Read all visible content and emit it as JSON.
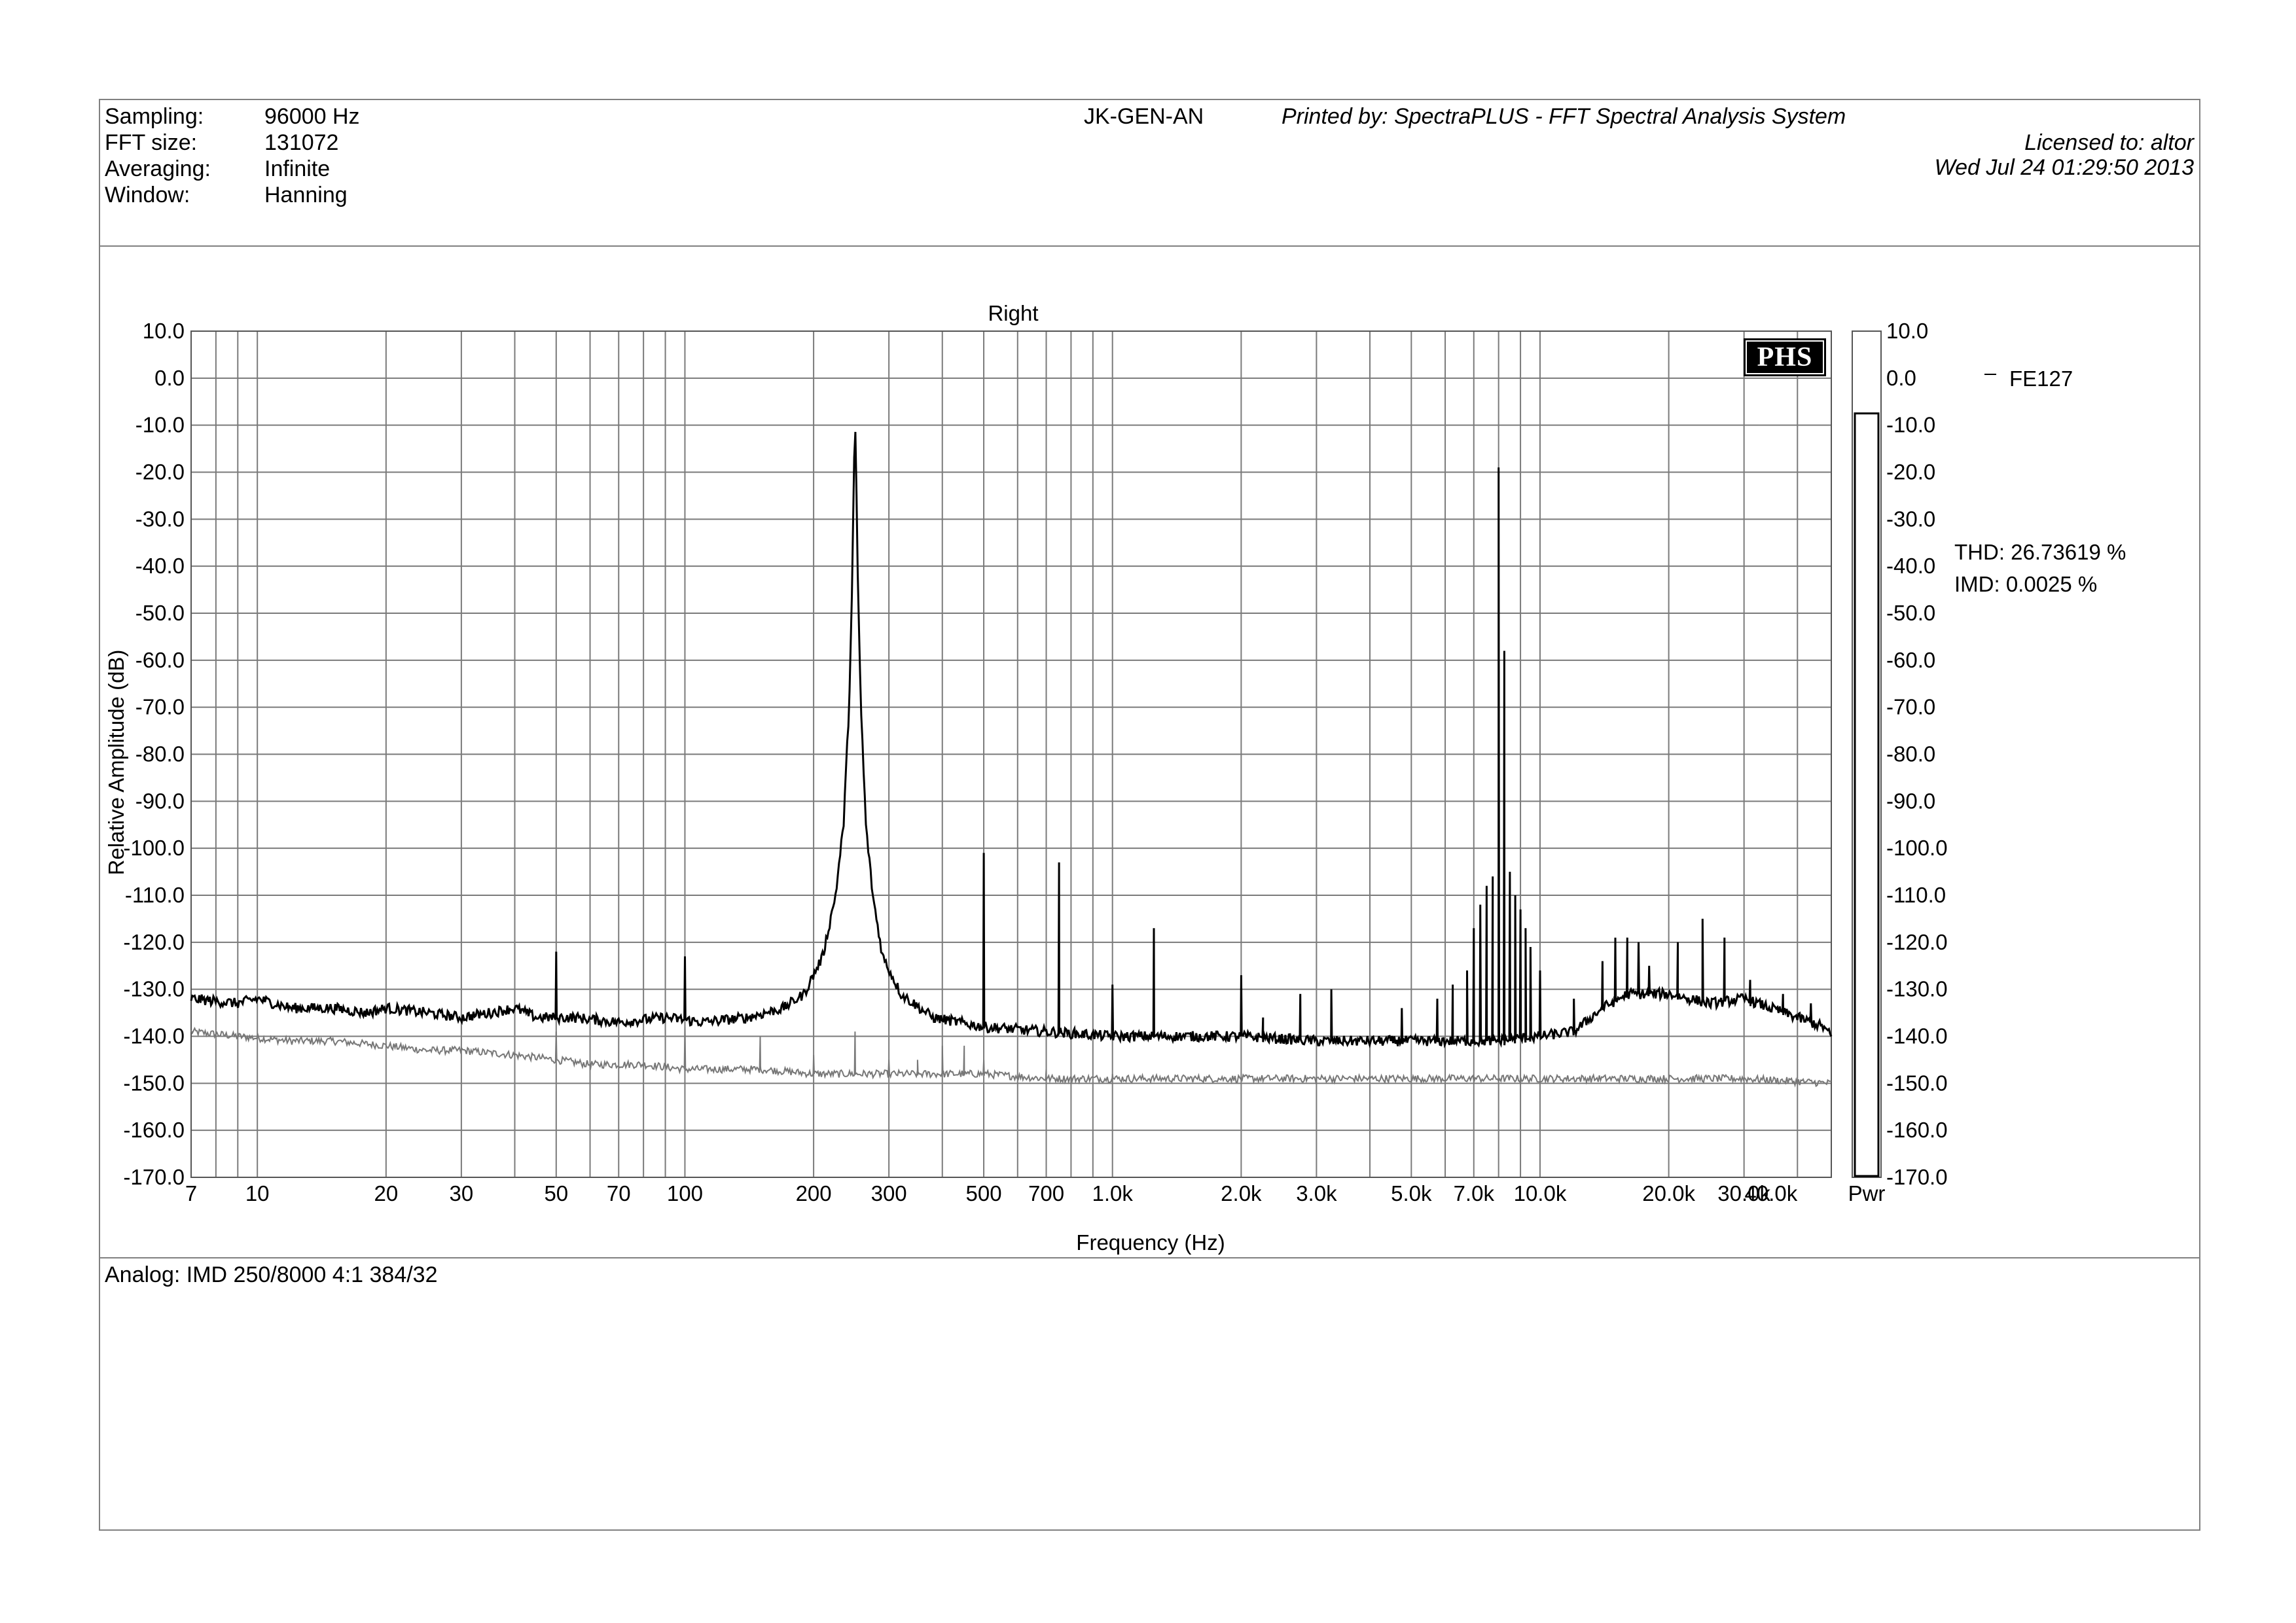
{
  "header": {
    "settings": [
      {
        "label": "Sampling:",
        "value": "96000 Hz"
      },
      {
        "label": "FFT size:",
        "value": "131072"
      },
      {
        "label": "Averaging:",
        "value": "Infinite"
      },
      {
        "label": "Window:",
        "value": "Hanning"
      }
    ],
    "device": "JK-GEN-AN",
    "printed_by": "Printed by: SpectraPLUS - FFT Spectral Analysis System",
    "licensed_to": "Licensed to: altor",
    "timestamp": "Wed Jul 24 01:29:50 2013"
  },
  "logo": {
    "text": "PHS"
  },
  "notes": {
    "text": "Analog: IMD 250/8000 4:1 384/32"
  },
  "measurements": {
    "thd": "THD: 26.73619 %",
    "imd": "IMD: 0.0025 %"
  },
  "chart_data": {
    "type": "line",
    "title": "Right",
    "xlabel": "Frequency (Hz)",
    "ylabel": "Relative Amplitude (dB)",
    "x_scale": "log",
    "xlim": [
      7,
      48000
    ],
    "ylim": [
      -170,
      10
    ],
    "grid": true,
    "legend_position": "right",
    "x_ticks": [
      {
        "value": 7,
        "label": "7"
      },
      {
        "value": 10,
        "label": "10"
      },
      {
        "value": 20,
        "label": "20"
      },
      {
        "value": 30,
        "label": "30"
      },
      {
        "value": 50,
        "label": "50"
      },
      {
        "value": 70,
        "label": "70"
      },
      {
        "value": 100,
        "label": "100"
      },
      {
        "value": 200,
        "label": "200"
      },
      {
        "value": 300,
        "label": "300"
      },
      {
        "value": 500,
        "label": "500"
      },
      {
        "value": 700,
        "label": "700"
      },
      {
        "value": 1000,
        "label": "1.0k"
      },
      {
        "value": 2000,
        "label": "2.0k"
      },
      {
        "value": 3000,
        "label": "3.0k"
      },
      {
        "value": 5000,
        "label": "5.0k"
      },
      {
        "value": 7000,
        "label": "7.0k"
      },
      {
        "value": 10000,
        "label": "10.0k"
      },
      {
        "value": 20000,
        "label": "20.0k"
      },
      {
        "value": 30000,
        "label": "30.0k"
      },
      {
        "value": 40000,
        "label": "40.0k"
      }
    ],
    "y_ticks": [
      {
        "value": 10,
        "label": "10.0"
      },
      {
        "value": 0,
        "label": "0.0"
      },
      {
        "value": -10,
        "label": "-10.0"
      },
      {
        "value": -20,
        "label": "-20.0"
      },
      {
        "value": -30,
        "label": "-30.0"
      },
      {
        "value": -40,
        "label": "-40.0"
      },
      {
        "value": -50,
        "label": "-50.0"
      },
      {
        "value": -60,
        "label": "-60.0"
      },
      {
        "value": -70,
        "label": "-70.0"
      },
      {
        "value": -80,
        "label": "-80.0"
      },
      {
        "value": -90,
        "label": "-90.0"
      },
      {
        "value": -100,
        "label": "-100.0"
      },
      {
        "value": -110,
        "label": "-110.0"
      },
      {
        "value": -120,
        "label": "-120.0"
      },
      {
        "value": -130,
        "label": "-130.0"
      },
      {
        "value": -140,
        "label": "-140.0"
      },
      {
        "value": -150,
        "label": "-150.0"
      },
      {
        "value": -160,
        "label": "-160.0"
      },
      {
        "value": -170,
        "label": "-170.0"
      }
    ],
    "series": [
      {
        "name": "FE127",
        "color": "#000000",
        "baseline": [
          [
            7,
            -132
          ],
          [
            9,
            -133
          ],
          [
            10,
            -132
          ],
          [
            12,
            -134
          ],
          [
            15,
            -134
          ],
          [
            18,
            -135
          ],
          [
            20,
            -134
          ],
          [
            25,
            -135
          ],
          [
            30,
            -136
          ],
          [
            35,
            -135
          ],
          [
            40,
            -134
          ],
          [
            45,
            -136
          ],
          [
            55,
            -136
          ],
          [
            70,
            -137
          ],
          [
            90,
            -136
          ],
          [
            110,
            -137
          ],
          [
            140,
            -136
          ],
          [
            170,
            -134
          ],
          [
            190,
            -131
          ],
          [
            210,
            -123
          ],
          [
            225,
            -110
          ],
          [
            235,
            -95
          ],
          [
            242,
            -70
          ],
          [
            246,
            -45
          ],
          [
            248,
            -25
          ],
          [
            250,
            -8.5
          ],
          [
            252,
            -25
          ],
          [
            254,
            -45
          ],
          [
            258,
            -70
          ],
          [
            265,
            -95
          ],
          [
            275,
            -110
          ],
          [
            290,
            -123
          ],
          [
            320,
            -131
          ],
          [
            380,
            -136
          ],
          [
            500,
            -138
          ],
          [
            700,
            -139
          ],
          [
            1000,
            -140
          ],
          [
            2000,
            -140
          ],
          [
            3000,
            -141
          ],
          [
            5000,
            -141
          ],
          [
            6000,
            -141
          ],
          [
            8000,
            -141
          ],
          [
            10000,
            -140
          ],
          [
            12000,
            -139
          ],
          [
            14000,
            -134
          ],
          [
            16000,
            -131
          ],
          [
            20000,
            -131
          ],
          [
            25000,
            -133
          ],
          [
            30000,
            -132
          ],
          [
            40000,
            -136
          ],
          [
            46000,
            -138
          ],
          [
            48000,
            -140
          ]
        ],
        "peaks": [
          [
            50,
            -122
          ],
          [
            100,
            -123
          ],
          [
            500,
            -101
          ],
          [
            750,
            -103
          ],
          [
            1000,
            -129
          ],
          [
            1250,
            -117
          ],
          [
            2000,
            -127
          ],
          [
            2250,
            -136
          ],
          [
            2750,
            -131
          ],
          [
            3250,
            -130
          ],
          [
            4750,
            -134
          ],
          [
            5750,
            -132
          ],
          [
            6250,
            -129
          ],
          [
            6750,
            -126
          ],
          [
            7000,
            -117
          ],
          [
            7250,
            -112
          ],
          [
            7500,
            -108
          ],
          [
            7750,
            -106
          ],
          [
            8000,
            -19
          ],
          [
            8250,
            -58
          ],
          [
            8500,
            -105
          ],
          [
            8750,
            -110
          ],
          [
            9000,
            -113
          ],
          [
            9250,
            -117
          ],
          [
            9500,
            -121
          ],
          [
            10000,
            -126
          ],
          [
            12000,
            -132
          ],
          [
            14000,
            -124
          ],
          [
            15000,
            -119
          ],
          [
            16000,
            -119
          ],
          [
            17000,
            -120
          ],
          [
            18000,
            -125
          ],
          [
            21000,
            -120
          ],
          [
            24000,
            -115
          ],
          [
            27000,
            -119
          ],
          [
            31000,
            -128
          ],
          [
            37000,
            -131
          ],
          [
            43000,
            -133
          ]
        ]
      },
      {
        "name": "",
        "color": "#777777",
        "baseline": [
          [
            7,
            -139
          ],
          [
            9,
            -140
          ],
          [
            12,
            -141
          ],
          [
            15,
            -141
          ],
          [
            20,
            -142
          ],
          [
            25,
            -143
          ],
          [
            30,
            -143
          ],
          [
            40,
            -144
          ],
          [
            50,
            -145
          ],
          [
            60,
            -146
          ],
          [
            80,
            -146
          ],
          [
            100,
            -147
          ],
          [
            150,
            -147
          ],
          [
            200,
            -148
          ],
          [
            300,
            -148
          ],
          [
            500,
            -148
          ],
          [
            700,
            -149
          ],
          [
            1000,
            -149
          ],
          [
            2000,
            -149
          ],
          [
            4000,
            -149
          ],
          [
            7000,
            -149
          ],
          [
            10000,
            -149
          ],
          [
            20000,
            -149
          ],
          [
            30000,
            -149
          ],
          [
            48000,
            -150
          ]
        ],
        "peaks": [
          [
            50,
            -139
          ],
          [
            100,
            -138
          ],
          [
            150,
            -140
          ],
          [
            200,
            -144
          ],
          [
            250,
            -139
          ],
          [
            300,
            -145
          ],
          [
            350,
            -145
          ],
          [
            400,
            -142
          ],
          [
            450,
            -142
          ],
          [
            500,
            -145
          ],
          [
            700,
            -147
          ],
          [
            1000,
            -148
          ]
        ]
      }
    ],
    "power_bar": {
      "label": "Pwr",
      "level_db": -7.5
    }
  }
}
